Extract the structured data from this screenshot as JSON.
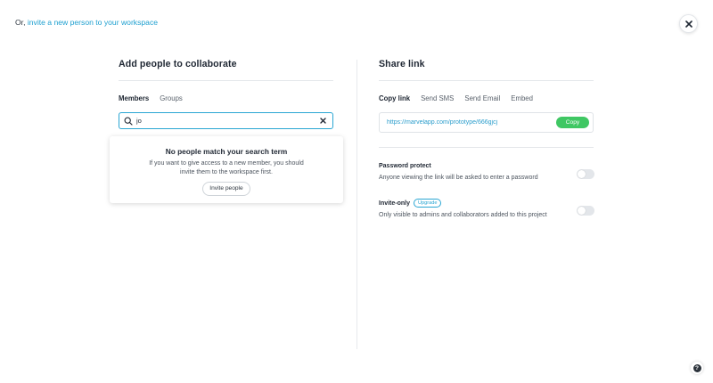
{
  "header": {
    "prefix": "Or,",
    "invite_link": "invite a new person to your workspace"
  },
  "left_panel": {
    "title": "Add people to collaborate",
    "tabs": [
      {
        "label": "Members",
        "active": true
      },
      {
        "label": "Groups",
        "active": false
      }
    ],
    "search": {
      "value": "jo",
      "placeholder": ""
    },
    "no_results": {
      "title": "No people match your search term",
      "description": "If you want to give access to a new member, you should invite them to the workspace first.",
      "button_label": "Invite people"
    }
  },
  "right_panel": {
    "title": "Share link",
    "tabs": [
      {
        "label": "Copy link",
        "active": true
      },
      {
        "label": "Send SMS",
        "active": false
      },
      {
        "label": "Send Email",
        "active": false
      },
      {
        "label": "Embed",
        "active": false
      }
    ],
    "share_url": "https://marvelapp.com/prototype/666gjcj",
    "copy_label": "Copy",
    "password_protect": {
      "title": "Password protect",
      "description": "Anyone viewing the link will be asked to enter a password",
      "enabled": false
    },
    "invite_only": {
      "title": "Invite-only",
      "badge": "Upgrade",
      "description": "Only visible to admins and collaborators added to this project",
      "enabled": false
    }
  },
  "help_label": "?",
  "colors": {
    "accent": "#2aa6d3",
    "link": "#1fa0d0",
    "copy_button": "#3fc763",
    "toggle_off": "#e3e6ea"
  }
}
